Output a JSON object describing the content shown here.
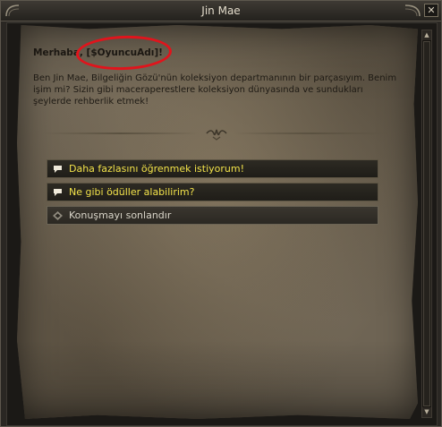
{
  "window": {
    "title": "Jin Mae"
  },
  "dialog": {
    "greeting": "Merhaba, [$OyuncuAdı]!",
    "body": "Ben Jin Mae, Bilgeliğin Gözü'nün koleksiyon departmanının bir parçasıyım. Benim işim mi? Sizin gibi maceraperestlere koleksiyon dünyasında ve sundukları şeylerde rehberlik etmek!"
  },
  "options": [
    {
      "label": "Daha fazlasını öğrenmek istiyorum!",
      "icon": "speech-bubble-icon"
    },
    {
      "label": "Ne gibi ödüller alabilirim?",
      "icon": "speech-bubble-icon"
    },
    {
      "label": "Konuşmayı sonlandır",
      "icon": "end-conversation-icon"
    }
  ],
  "colors": {
    "option_text": "#f2e24a",
    "end_text": "#d8d4c8",
    "annotation_circle": "#e0141c",
    "parchment": "#6e6454"
  }
}
